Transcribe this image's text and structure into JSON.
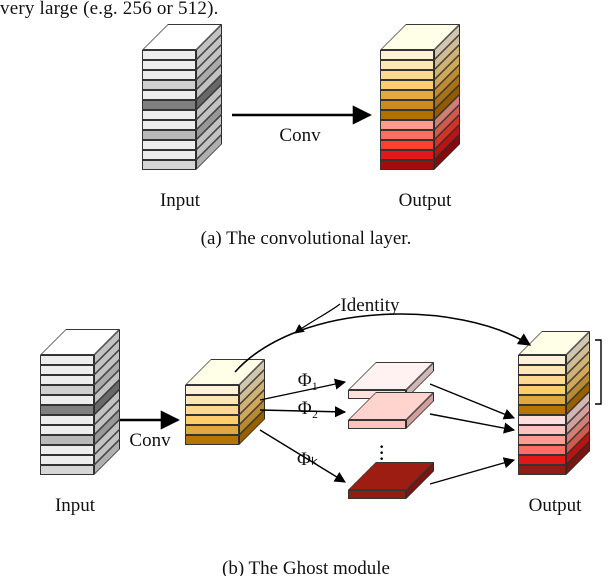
{
  "top_crop_text": "very large (e.g. 256 or 512).",
  "panel_a": {
    "input_label": "Input",
    "op_label": "Conv",
    "output_label": "Output",
    "caption": "(a)  The convolutional layer.",
    "input_colors": [
      "#ededed",
      "#ededed",
      "#ededed",
      "#cfcfcf",
      "#ededed",
      "#7f7f7f",
      "#ededed",
      "#ededed",
      "#b9b9b9",
      "#ededed",
      "#ededed",
      "#d6d6d6"
    ],
    "output_colors": [
      "#fff2d6",
      "#ffe6b3",
      "#ffd98f",
      "#ffcd6c",
      "#e6a93e",
      "#cc8b1f",
      "#b36e00",
      "#ff9a8f",
      "#ff6e60",
      "#ff4030",
      "#e01818",
      "#a30c0c"
    ]
  },
  "panel_b": {
    "input_label": "Input",
    "op_label": "Conv",
    "identity_label": "Identity",
    "output_label": "Output",
    "phi_labels": [
      "Φ₁",
      "Φ₂",
      "Φₖ"
    ],
    "caption": "(b)  The Ghost module",
    "input_colors": [
      "#ededed",
      "#ededed",
      "#ededed",
      "#cfcfcf",
      "#ededed",
      "#7f7f7f",
      "#ededed",
      "#ededed",
      "#b9b9b9",
      "#ededed",
      "#ededed",
      "#d6d6d6"
    ],
    "intrinsic_colors": [
      "#fff2d6",
      "#ffe6b3",
      "#ffd98f",
      "#ffcd6c",
      "#e0a83e",
      "#b87400"
    ],
    "tile_colors": [
      "#ffe0de",
      "#ffc3bf",
      "#921b12"
    ],
    "output_colors": [
      "#fff2d6",
      "#ffe6b3",
      "#ffd98f",
      "#ffcd6c",
      "#e0a83e",
      "#b87400",
      "#ffdedb",
      "#ffc3bf",
      "#ff9a8f",
      "#ff6e60",
      "#e01818",
      "#921b12"
    ]
  }
}
